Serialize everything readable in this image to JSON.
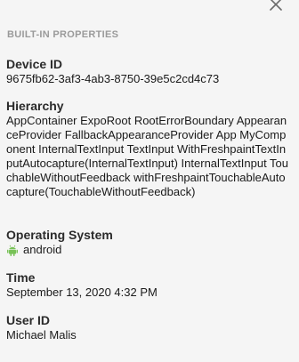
{
  "header": {
    "section_title": "BUILT-IN PROPERTIES",
    "close_icon": "close-icon"
  },
  "properties": {
    "device_id": {
      "label": "Device ID",
      "value": "9675fb62-3af3-4ab3-8750-39e5c2cd4c73"
    },
    "hierarchy": {
      "label": "Hierarchy",
      "value": "AppContainer ExpoRoot RootErrorBoundary AppearanceProvider FallbackAppearanceProvider App MyComponent InternalTextInput TextInput WithFreshpaintTextInputAutocapture(InternalTextInput) InternalTextInput TouchableWithoutFeedback withFreshpaintTouchableAutocapture(TouchableWithoutFeedback)"
    },
    "operating_system": {
      "label": "Operating System",
      "value": "android",
      "icon": "android-icon",
      "icon_color": "#78c257"
    },
    "time": {
      "label": "Time",
      "value": "September 13, 2020 4:32 PM"
    },
    "user_id": {
      "label": "User ID",
      "value": "Michael Malis"
    }
  }
}
